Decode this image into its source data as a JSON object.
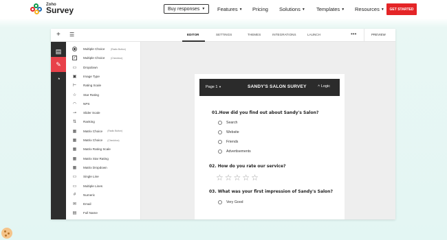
{
  "brand": {
    "zoho": "Zoho",
    "survey": "Survey"
  },
  "nav": {
    "buy_label": "Buy responses",
    "items": [
      "Features",
      "Pricing",
      "Solutions",
      "Templates",
      "Resources"
    ],
    "cta": "GET STARTED"
  },
  "toolbar": {
    "tabs": [
      "EDITOR",
      "SETTINGS",
      "THEMES",
      "INTEGRATIONS",
      "LAUNCH"
    ],
    "active_tab": "EDITOR",
    "preview": "PREVIEW"
  },
  "question_types": [
    {
      "icon": "radio-icon",
      "label": "Multiple Choice",
      "sub": "(Radio Button)"
    },
    {
      "icon": "checkbox-icon",
      "label": "Multiple Choice",
      "sub": "(Checkbox)"
    },
    {
      "icon": "dropdown-icon",
      "label": "Dropdown",
      "sub": ""
    },
    {
      "icon": "image-icon",
      "label": "Image Type",
      "sub": ""
    },
    {
      "icon": "rating-scale-icon",
      "label": "Rating Scale",
      "sub": ""
    },
    {
      "icon": "star-icon",
      "label": "Star Rating",
      "sub": ""
    },
    {
      "icon": "nps-icon",
      "label": "NPS",
      "sub": ""
    },
    {
      "icon": "slider-icon",
      "label": "Slider Scale",
      "sub": ""
    },
    {
      "icon": "ranking-icon",
      "label": "Ranking",
      "sub": ""
    },
    {
      "icon": "matrix-radio-icon",
      "label": "Matrix Choice",
      "sub": "(Radio Button)"
    },
    {
      "icon": "matrix-checkbox-icon",
      "label": "Matrix Choice",
      "sub": "(Checkbox)"
    },
    {
      "icon": "matrix-rating-icon",
      "label": "Matrix Rating Scale",
      "sub": ""
    },
    {
      "icon": "matrix-star-icon",
      "label": "Matrix Star Rating",
      "sub": ""
    },
    {
      "icon": "matrix-dropdown-icon",
      "label": "Matrix Dropdown",
      "sub": ""
    },
    {
      "icon": "single-line-icon",
      "label": "Single Line",
      "sub": ""
    },
    {
      "icon": "multiple-lines-icon",
      "label": "Multiple Lines",
      "sub": ""
    },
    {
      "icon": "numeric-icon",
      "label": "Numeric",
      "sub": ""
    },
    {
      "icon": "email-icon",
      "label": "Email",
      "sub": ""
    },
    {
      "icon": "full-name-icon",
      "label": "Full Name",
      "sub": ""
    }
  ],
  "survey": {
    "page": "Page 1",
    "title": "SANDY'S SALON SURVEY",
    "logic": "Logic",
    "q1": {
      "text": "01.How did you find out about Sandy's Salon?",
      "options": [
        "Search",
        "Website",
        "Friends",
        "Advertisements"
      ]
    },
    "q2": {
      "text": "02. How do you rate our service?",
      "stars": 5
    },
    "q3": {
      "text": "03. What was your first impression of Sandy's Salon?",
      "options": [
        "Very Good"
      ]
    }
  }
}
